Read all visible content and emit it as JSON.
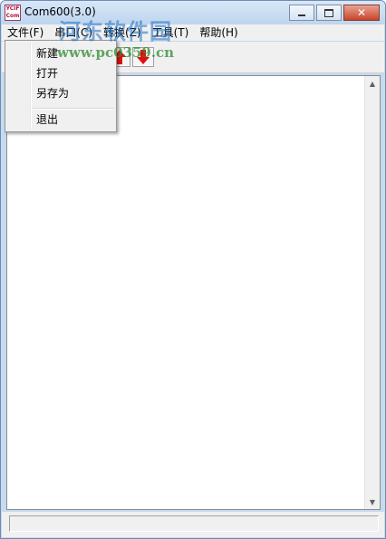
{
  "window": {
    "title": "Com600(3.0)",
    "app_icon_lines": [
      "YCIF",
      "Com"
    ]
  },
  "menubar": {
    "items": [
      "文件(F)",
      "串口(C)",
      "转换(Z)",
      "工具(T)",
      "帮助(H)"
    ]
  },
  "file_menu": {
    "items": [
      "新建",
      "打开",
      "另存为",
      "退出"
    ]
  },
  "watermark": {
    "line1": "河东软件园",
    "line2": "www.pc0359.cn"
  },
  "colors": {
    "arrow_red": "#e01010",
    "watermark_blue": "#1a6fc4",
    "watermark_green": "#2e8b2e"
  }
}
